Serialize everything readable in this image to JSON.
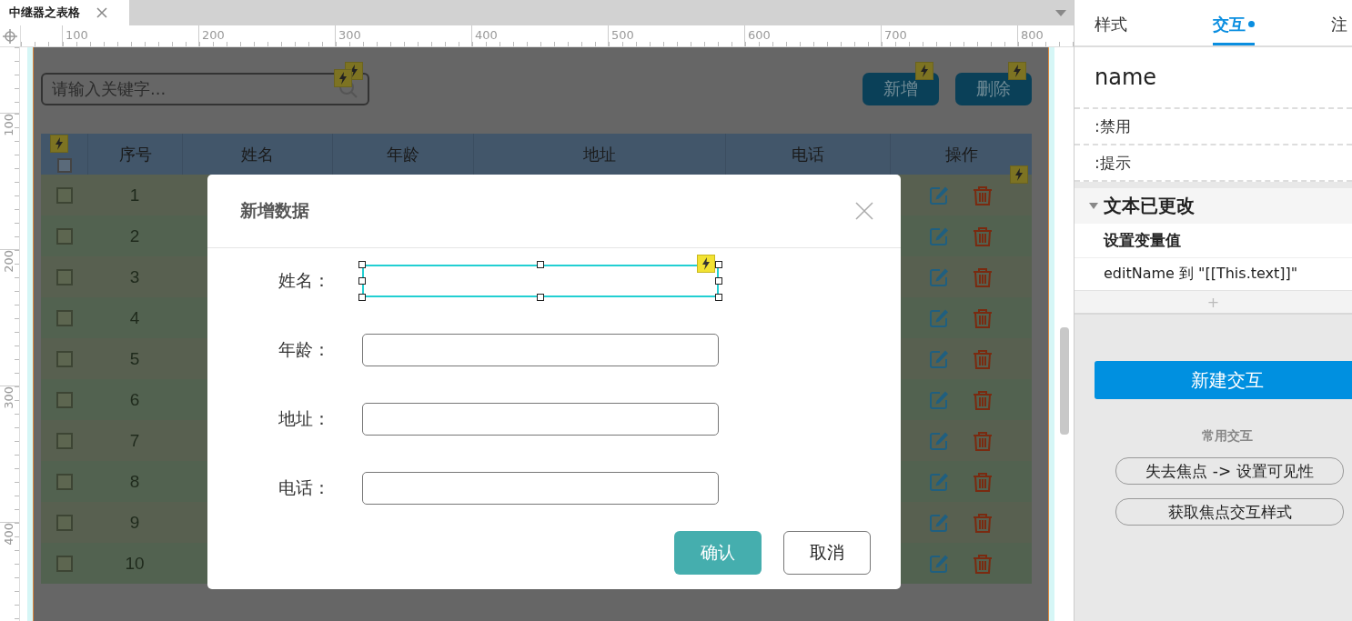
{
  "document_tab": {
    "title": "中继器之表格"
  },
  "rulers": {
    "horizontal": [
      "100",
      "200",
      "300",
      "400",
      "500",
      "600",
      "700",
      "800"
    ],
    "vertical": [
      "100",
      "200",
      "300",
      "400"
    ]
  },
  "canvas": {
    "search": {
      "placeholder": "请输入关键字..."
    },
    "buttons": [
      "新增",
      "删除"
    ],
    "table": {
      "columns": [
        "序号",
        "姓名",
        "年龄",
        "地址",
        "电话",
        "操作"
      ],
      "header_checked": false,
      "rows": [
        {
          "index": "1",
          "checked": false
        },
        {
          "index": "2",
          "checked": false
        },
        {
          "index": "3",
          "checked": false
        },
        {
          "index": "4",
          "checked": false
        },
        {
          "index": "5",
          "checked": false
        },
        {
          "index": "6",
          "checked": false
        },
        {
          "index": "7",
          "checked": false
        },
        {
          "index": "8",
          "checked": false
        },
        {
          "index": "9",
          "checked": false
        },
        {
          "index": "10",
          "checked": false
        }
      ]
    }
  },
  "dialog": {
    "title": "新增数据",
    "fields": [
      {
        "label": "姓名：",
        "selected": true
      },
      {
        "label": "年龄：",
        "selected": false
      },
      {
        "label": "地址：",
        "selected": false
      },
      {
        "label": "电话：",
        "selected": false
      }
    ],
    "buttons": [
      {
        "label": "确认",
        "kind": "primary"
      },
      {
        "label": "取消",
        "kind": "secondary"
      }
    ]
  },
  "inspector": {
    "tabs": [
      {
        "label": "样式",
        "selected": false,
        "dot": false
      },
      {
        "label": "交互",
        "selected": true,
        "dot": true
      },
      {
        "label": "注",
        "selected": false,
        "dot": false
      }
    ],
    "widget_name": "name",
    "states": [
      ":禁用",
      ":提示"
    ],
    "events": [
      {
        "name": "文本已更改",
        "expanded": true,
        "actions": [
          {
            "name": "设置变量值",
            "detail": "editName 到 \"[[This.text]]\""
          }
        ]
      }
    ],
    "add_symbol": "+",
    "new_button": "新建交互",
    "common_title": "常用交互",
    "common": [
      "失去焦点 -> 设置可见性",
      "获取焦点交互样式"
    ]
  }
}
